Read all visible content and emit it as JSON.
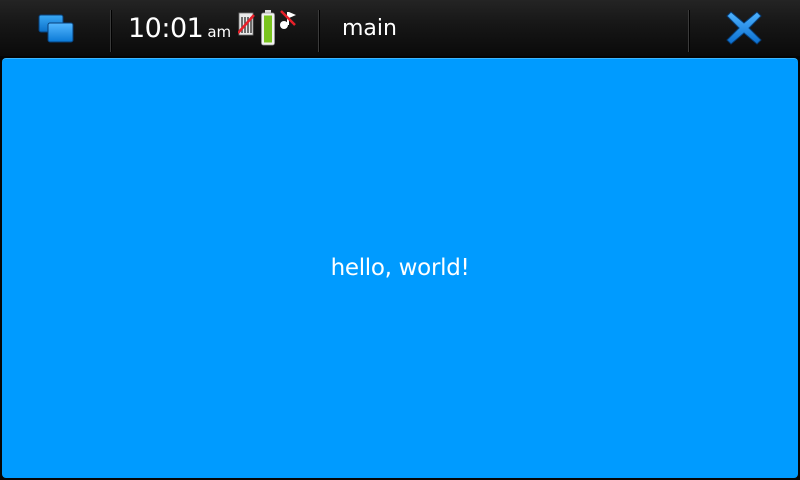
{
  "statusbar": {
    "task_switcher_icon": "task-switcher-icon",
    "clock": {
      "time": "10:01",
      "ampm": "am"
    },
    "indicators": {
      "signal": "no-signal-icon",
      "battery": "battery-full-icon",
      "sound": "sound-muted-icon"
    },
    "app_title": "main",
    "close_icon": "close-icon"
  },
  "content": {
    "message": "hello, world!",
    "background_color": "#009bff"
  },
  "colors": {
    "accent": "#0a7fd8",
    "battery_fill": "#7ac41f",
    "mute_mark": "#e8202a"
  }
}
